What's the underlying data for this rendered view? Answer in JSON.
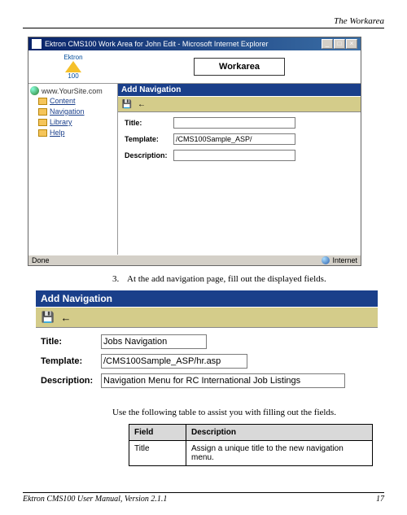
{
  "header": {
    "section_title": "The Workarea"
  },
  "browser": {
    "title": "Ektron CMS100 Work Area for John Edit - Microsoft Internet Explorer",
    "logo_brand": "Ektron",
    "logo_product": "100",
    "workarea_label": "Workarea",
    "status_left": "Done",
    "status_right": "Internet"
  },
  "sidebar": {
    "site": "www.YourSite.com",
    "items": [
      {
        "label": "Content"
      },
      {
        "label": "Navigation"
      },
      {
        "label": "Library"
      },
      {
        "label": "Help"
      }
    ]
  },
  "panel_small": {
    "title": "Add Navigation",
    "fields": {
      "title_label": "Title:",
      "title_value": "",
      "template_label": "Template:",
      "template_value": "/CMS100Sample_ASP/",
      "description_label": "Description:",
      "description_value": ""
    }
  },
  "step3": {
    "num": "3.",
    "text": "At the add navigation page, fill out the displayed fields."
  },
  "panel_large": {
    "title": "Add Navigation",
    "fields": {
      "title_label": "Title:",
      "title_value": "Jobs Navigation",
      "template_label": "Template:",
      "template_value": "/CMS100Sample_ASP/hr.asp",
      "description_label": "Description:",
      "description_value": "Navigation Menu for RC International Job Listings"
    }
  },
  "table_intro": "Use the following table to assist you with filling out the fields.",
  "field_table": {
    "headers": [
      "Field",
      "Description"
    ],
    "rows": [
      [
        "Title",
        "Assign a unique title to the new navigation menu."
      ]
    ]
  },
  "footer": {
    "left": "Ektron CMS100 User Manual, Version 2.1.1",
    "right": "17"
  }
}
